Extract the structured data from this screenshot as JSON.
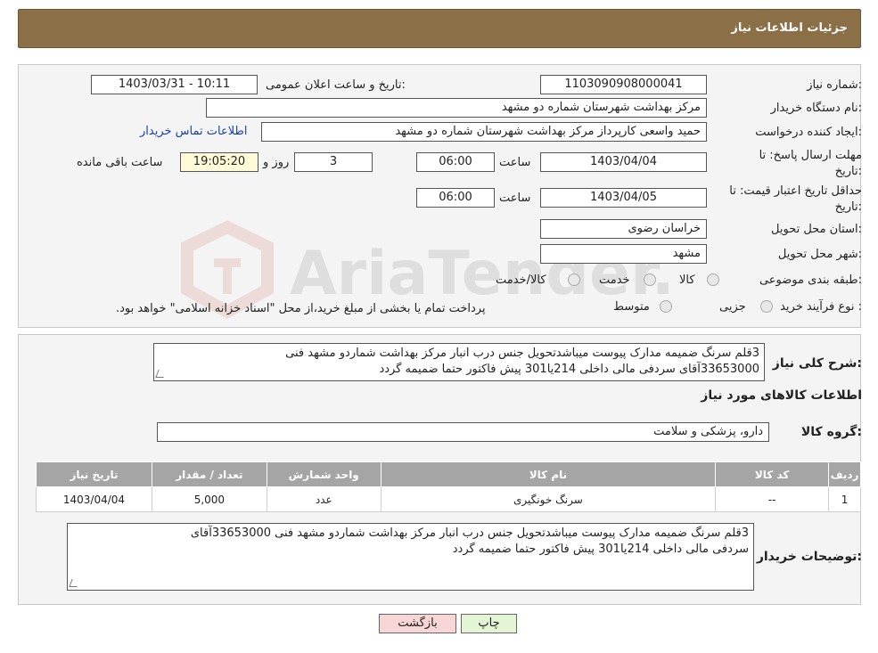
{
  "header": {
    "title": "جزئیات اطلاعات نیاز"
  },
  "need_number": {
    "label": "شماره نیاز:",
    "value": "1103090908000041"
  },
  "announce_datetime": {
    "label": "تاریخ و ساعت اعلان عمومی:",
    "value": "1403/03/31 - 10:11"
  },
  "buyer_org": {
    "label": "نام دستگاه خریدار:",
    "value": "مرکز بهداشت شهرستان شماره دو مشهد"
  },
  "requester": {
    "label": "ایجاد کننده درخواست:",
    "value": "حمید واسعی کارپرداز مرکز بهداشت شهرستان شماره دو مشهد",
    "contact_link": "اطلاعات تماس خریدار"
  },
  "reply_deadline": {
    "label": "مهلت ارسال پاسخ: تا تاریخ:",
    "date": "1403/04/04",
    "time_label": "ساعت",
    "time": "06:00",
    "days": "3",
    "days_label": "روز و",
    "remaining": "19:05:20",
    "remaining_label": "ساعت باقی مانده"
  },
  "price_validity": {
    "label": "حداقل تاریخ اعتبار قیمت: تا تاریخ:",
    "date": "1403/04/05",
    "time_label": "ساعت",
    "time": "06:00"
  },
  "province": {
    "label": "استان محل تحویل:",
    "value": "خراسان رضوی"
  },
  "city": {
    "label": "شهر محل تحویل:",
    "value": "مشهد"
  },
  "category": {
    "label": "طبقه بندی موضوعی:",
    "options": [
      "کالا",
      "خدمت",
      "کالا/خدمت"
    ]
  },
  "purchase_type": {
    "label": "نوع فرآیند خرید :",
    "options": [
      "جزیی",
      "متوسط"
    ],
    "note": "پرداخت تمام یا بخشی از مبلغ خرید،از محل \"اسناد خزانه اسلامی\" خواهد بود."
  },
  "description": {
    "label": "شرح کلی نیاز:",
    "line1": "3قلم سرنگ ضمیمه مدارک پیوست میباشدتحویل جنس درب انبار مرکز بهداشت شماردو مشهد فنی",
    "line2": "33653000آقای سردفی مالی داخلی 214یا301 پیش فاکتور حتما ضمیمه گردد"
  },
  "goods_section": {
    "title": "اطلاعات کالاهای مورد نیاز"
  },
  "goods_group": {
    "label": "گروه کالا:",
    "value": "دارو، پزشکی و سلامت"
  },
  "table": {
    "headers": [
      "ردیف",
      "کد کالا",
      "نام کالا",
      "واحد شمارش",
      "تعداد / مقدار",
      "تاریخ نیاز"
    ],
    "rows": [
      {
        "row": "1",
        "code": "--",
        "name": "سرنگ خونگیری",
        "unit": "عدد",
        "qty": "5,000",
        "date": "1403/04/04"
      }
    ]
  },
  "buyer_notes": {
    "label": "توضیحات خریدار:",
    "line1": "3قلم سرنگ ضمیمه مدارک پیوست میباشدتحویل جنس درب انبار مرکز بهداشت شماردو مشهد فنی 33653000آقای",
    "line2": "سردفی مالی داخلی 214یا301 پیش فاکتور حتما ضمیمه گردد"
  },
  "buttons": {
    "print": "چاپ",
    "back": "بازگشت"
  },
  "watermark": {
    "text": "AriaTender.neT"
  }
}
